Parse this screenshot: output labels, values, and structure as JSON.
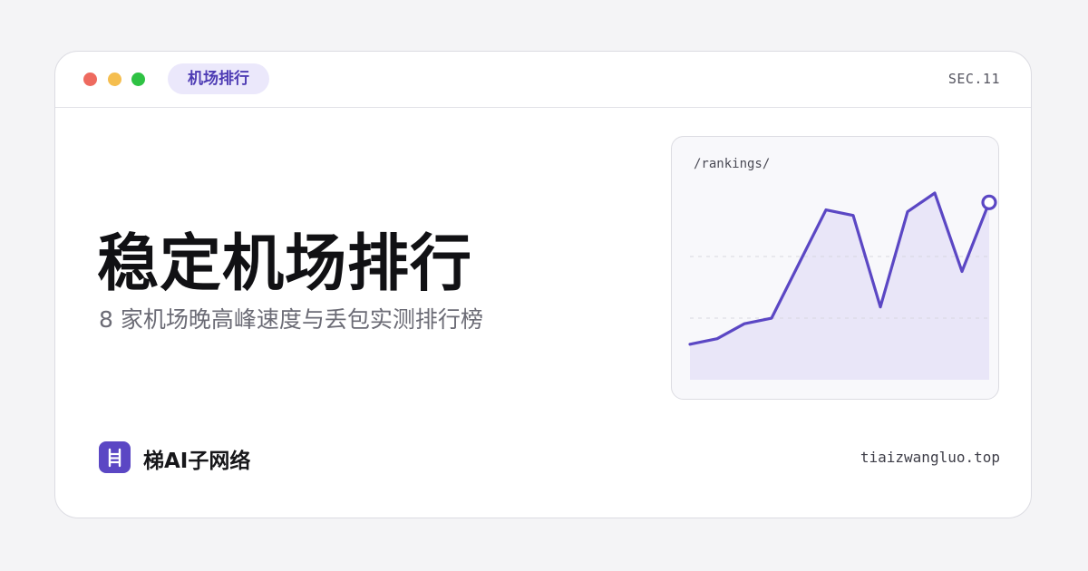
{
  "window": {
    "controls": [
      {
        "name": "close",
        "color": "#ee6a5f"
      },
      {
        "name": "minimize",
        "color": "#f5be4f"
      },
      {
        "name": "maximize",
        "color": "#2ec243"
      }
    ],
    "tab_label": "机场排行",
    "section_label": "SEC.11"
  },
  "hero": {
    "title": "稳定机场排行",
    "subtitle": "8 家机场晚高峰速度与丢包实测排行榜"
  },
  "chart_panel": {
    "path_label": "/rankings/"
  },
  "chart_data": {
    "type": "area",
    "x": [
      0,
      1,
      2,
      3,
      4,
      5,
      6,
      7,
      8,
      9,
      10,
      11
    ],
    "values": [
      0.19,
      0.22,
      0.3,
      0.33,
      0.62,
      0.91,
      0.88,
      0.39,
      0.9,
      1.0,
      0.58,
      0.95
    ],
    "ylim": [
      0,
      1
    ],
    "grid": "dashed-horizontal",
    "end_marker": true,
    "colors": {
      "line": "#5b47c4",
      "fill": "#e9e6f8",
      "grid": "#d7d7df"
    }
  },
  "footer": {
    "brand_name": "梯AI子网络",
    "brand_icon": "ladder-icon",
    "domain": "tiaizwangluo.top"
  },
  "theme": {
    "accent": "#5b47c4",
    "tab_bg": "#ebe8fb",
    "tab_text": "#4d3bb4",
    "logo_bg": "#5b47c4"
  }
}
